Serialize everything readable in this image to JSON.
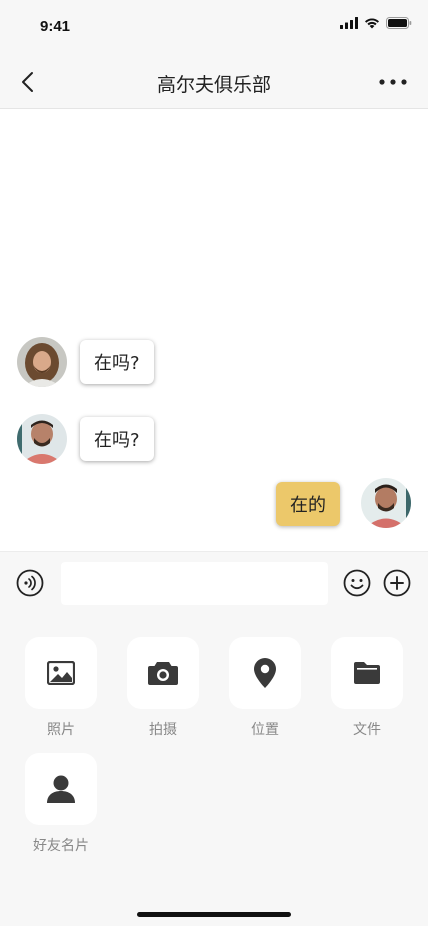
{
  "status_bar": {
    "time": "9:41"
  },
  "nav": {
    "title": "高尔夫俱乐部"
  },
  "messages": [
    {
      "side": "left",
      "text": "在吗?"
    },
    {
      "side": "left",
      "text": "在吗?"
    },
    {
      "side": "right",
      "text": "在的"
    }
  ],
  "input": {
    "value": "",
    "placeholder": ""
  },
  "tools": [
    {
      "label": "照片",
      "icon": "image-icon"
    },
    {
      "label": "拍摄",
      "icon": "camera-icon"
    },
    {
      "label": "位置",
      "icon": "location-pin-icon"
    },
    {
      "label": "文件",
      "icon": "folder-icon"
    },
    {
      "label": "好友名片",
      "icon": "contact-card-icon"
    }
  ],
  "colors": {
    "my_bubble": "#ecc86a",
    "background": "#f7f7f7"
  }
}
